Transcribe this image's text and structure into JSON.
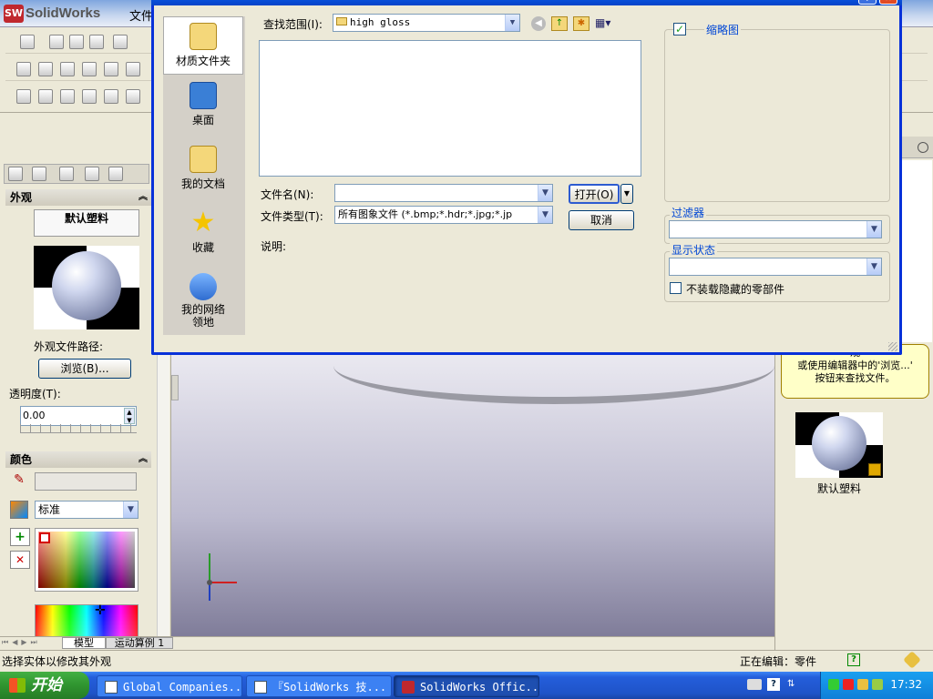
{
  "app": {
    "title": "SolidWorks",
    "menu_file": "文件"
  },
  "left_panel": {
    "appearance_header": "外观",
    "default_material": "默认塑料",
    "path_label": "外观文件路径:",
    "browse_button": "浏览(B)...",
    "transparency_label": "透明度(T):",
    "transparency_value": "0.00",
    "color_header": "颜色",
    "color_mode": "标准",
    "colors": {
      "accent": "#316ac5",
      "selection": "#d40000"
    }
  },
  "right_panel": {
    "tooltip_text": "观\n或使用编辑器中的'浏览...'\n按钮来查找文件。",
    "thumbnail_label": "默认塑料"
  },
  "bottom_tabs": [
    "模型",
    "运动算例 1"
  ],
  "status": {
    "left": "选择实体以修改其外观",
    "right": "正在编辑：零件"
  },
  "dialog": {
    "places": [
      "材质文件夹",
      "桌面",
      "我的文档",
      "收藏",
      "我的网络\n领地"
    ],
    "lookin_label": "查找范围(I):",
    "lookin_value": "high gloss",
    "filename_label": "文件名(N):",
    "filename_value": "",
    "filetype_label": "文件类型(T):",
    "filetype_value": "所有图象文件 (*.bmp;*.hdr;*.jpg;*.jp",
    "description_label": "说明:",
    "open_button": "打开(O)",
    "cancel_button": "取消",
    "thumbnail_label": "缩略图",
    "thumbnail_checked": true,
    "filter_label": "过滤器",
    "display_state_label": "显示状态",
    "no_load_hidden_label": "不装载隐藏的零部件",
    "no_load_hidden_checked": false
  },
  "taskbar": {
    "start": "开始",
    "items": [
      "Global Companies...",
      "『SolidWorks 技...",
      "SolidWorks Offic..."
    ],
    "clock": "17:32"
  }
}
